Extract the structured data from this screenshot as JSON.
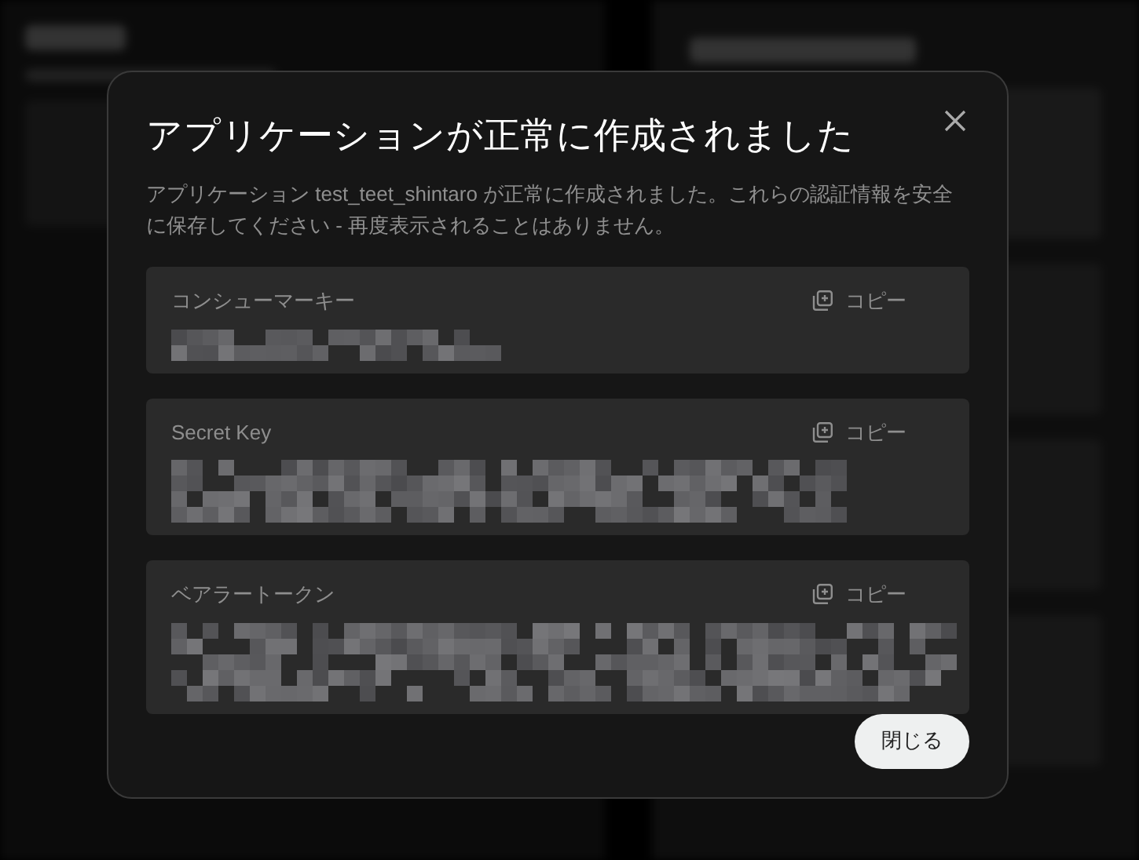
{
  "dialog": {
    "title": "アプリケーションが正常に作成されました",
    "description": "アプリケーション test_teet_shintaro が正常に作成されました。これらの認証情報を安全に保存してください - 再度表示されることはありません。",
    "credentials": [
      {
        "label": "コンシューマーキー",
        "copy": "コピー"
      },
      {
        "label": "Secret Key",
        "copy": "コピー"
      },
      {
        "label": "ベアラートークン",
        "copy": "コピー"
      }
    ],
    "close_button": "閉じる"
  }
}
